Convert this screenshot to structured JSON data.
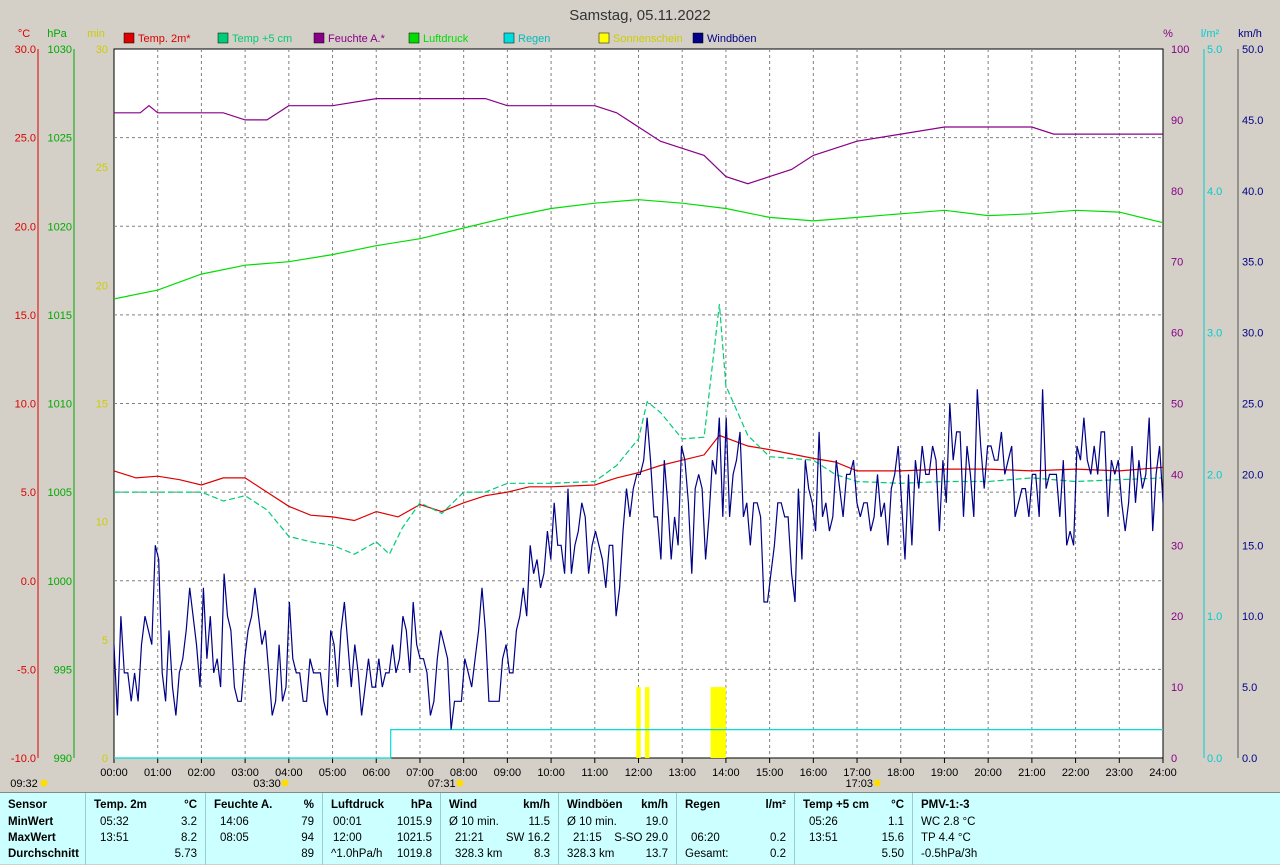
{
  "title": "Samstag, 05.11.2022",
  "colors": {
    "temp2m": "#dd0000",
    "temp5cm": "#00cc77",
    "humidity": "#880088",
    "pressure": "#00dd00",
    "rain": "#00dddd",
    "sunshine": "#ffff00",
    "gusts": "#000088",
    "grid": "#808080",
    "panel_bg": "#ccffff",
    "frame_bg": "#d4d0c8",
    "plot_bg": "#ffffff"
  },
  "legend": [
    {
      "label": "Temp. 2m*",
      "color": "#dd0000"
    },
    {
      "label": "Temp +5 cm",
      "color": "#00cc77"
    },
    {
      "label": "Feuchte A.*",
      "color": "#880088"
    },
    {
      "label": "Luftdruck",
      "color": "#00dd00"
    },
    {
      "label": "Regen",
      "color": "#00dddd"
    },
    {
      "label": "Sonnenschein",
      "color": "#ffff00"
    },
    {
      "label": "Windböen",
      "color": "#000088"
    }
  ],
  "axes": {
    "temp": {
      "unit": "°C",
      "min": -10,
      "max": 30,
      "ticks": [
        "-10.0",
        "-5.0",
        "0.0",
        "5.0",
        "10.0",
        "15.0",
        "20.0",
        "25.0",
        "30.0"
      ]
    },
    "pressure": {
      "unit": "hPa",
      "min": 990,
      "max": 1030,
      "ticks": [
        "990",
        "995",
        "1000",
        "1005",
        "1010",
        "1015",
        "1020",
        "1025",
        "1030"
      ]
    },
    "sun_min": {
      "unit": "min",
      "min": 0,
      "max": 30,
      "ticks": [
        "0",
        "5",
        "10",
        "15",
        "20",
        "25",
        "30"
      ]
    },
    "humidity": {
      "unit": "%",
      "min": 0,
      "max": 100,
      "ticks": [
        "0",
        "10",
        "20",
        "30",
        "40",
        "50",
        "60",
        "70",
        "80",
        "90",
        "100"
      ]
    },
    "rain": {
      "unit": "l/m²",
      "min": 0,
      "max": 5,
      "ticks": [
        "0.0",
        "1.0",
        "2.0",
        "3.0",
        "4.0",
        "5.0"
      ]
    },
    "wind": {
      "unit": "km/h",
      "min": 0,
      "max": 50,
      "ticks": [
        "0.0",
        "5.0",
        "10.0",
        "15.0",
        "20.0",
        "25.0",
        "30.0",
        "35.0",
        "40.0",
        "45.0",
        "50.0"
      ]
    },
    "x_ticks": [
      "00:00",
      "01:00",
      "02:00",
      "03:00",
      "04:00",
      "05:00",
      "06:00",
      "07:00",
      "08:00",
      "09:00",
      "10:00",
      "11:00",
      "12:00",
      "13:00",
      "14:00",
      "15:00",
      "16:00",
      "17:00",
      "18:00",
      "19:00",
      "20:00",
      "21:00",
      "22:00",
      "23:00",
      "24:00"
    ]
  },
  "markers": [
    {
      "label": "09:32",
      "hour": -2.5
    },
    {
      "label": "03:30",
      "hour": 3.5
    },
    {
      "label": "07:31",
      "hour": 7.5
    },
    {
      "label": "17:03",
      "hour": 17.05
    }
  ],
  "chart_data": {
    "type": "line",
    "x_unit": "hour",
    "series": [
      {
        "name": "Temp. 2m*",
        "axis": "temp",
        "style": "line",
        "points": [
          [
            0,
            6.2
          ],
          [
            0.5,
            5.8
          ],
          [
            1,
            5.9
          ],
          [
            1.5,
            5.7
          ],
          [
            2,
            5.4
          ],
          [
            2.5,
            5.8
          ],
          [
            3,
            5.8
          ],
          [
            3.5,
            5.0
          ],
          [
            4,
            4.2
          ],
          [
            4.5,
            3.7
          ],
          [
            5,
            3.6
          ],
          [
            5.5,
            3.4
          ],
          [
            6,
            3.9
          ],
          [
            6.5,
            3.6
          ],
          [
            7,
            4.3
          ],
          [
            7.5,
            3.9
          ],
          [
            8,
            4.4
          ],
          [
            8.5,
            4.8
          ],
          [
            9,
            5.0
          ],
          [
            9.5,
            5.3
          ],
          [
            10,
            5.3
          ],
          [
            11,
            5.4
          ],
          [
            11.5,
            5.8
          ],
          [
            12,
            6.1
          ],
          [
            12.5,
            6.5
          ],
          [
            13,
            6.8
          ],
          [
            13.5,
            7.1
          ],
          [
            13.85,
            8.2
          ],
          [
            14.5,
            7.6
          ],
          [
            15,
            7.4
          ],
          [
            16,
            6.9
          ],
          [
            16.5,
            6.7
          ],
          [
            17,
            6.2
          ],
          [
            18,
            6.2
          ],
          [
            19,
            6.3
          ],
          [
            20,
            6.3
          ],
          [
            21,
            6.2
          ],
          [
            22,
            6.3
          ],
          [
            23,
            6.2
          ],
          [
            24,
            6.4
          ]
        ]
      },
      {
        "name": "Temp +5 cm",
        "axis": "temp",
        "style": "dash",
        "points": [
          [
            0,
            5.0
          ],
          [
            1,
            5.0
          ],
          [
            2,
            5.0
          ],
          [
            2.5,
            4.5
          ],
          [
            3,
            4.8
          ],
          [
            3.5,
            4.0
          ],
          [
            4,
            2.5
          ],
          [
            4.5,
            2.2
          ],
          [
            5,
            2.0
          ],
          [
            5.5,
            1.5
          ],
          [
            6,
            2.2
          ],
          [
            6.3,
            1.5
          ],
          [
            6.6,
            3.0
          ],
          [
            7,
            4.4
          ],
          [
            7.5,
            3.8
          ],
          [
            8,
            5.0
          ],
          [
            8.5,
            5.0
          ],
          [
            9,
            5.5
          ],
          [
            10,
            5.5
          ],
          [
            11,
            5.6
          ],
          [
            11.5,
            6.5
          ],
          [
            12,
            8.0
          ],
          [
            12.2,
            10.1
          ],
          [
            12.5,
            9.5
          ],
          [
            13,
            8.0
          ],
          [
            13.5,
            8.1
          ],
          [
            13.85,
            15.6
          ],
          [
            14,
            11.0
          ],
          [
            14.5,
            8.2
          ],
          [
            15,
            7.0
          ],
          [
            16,
            6.8
          ],
          [
            16.5,
            6.0
          ],
          [
            17,
            5.6
          ],
          [
            18,
            5.5
          ],
          [
            19,
            5.6
          ],
          [
            20,
            5.6
          ],
          [
            21,
            5.8
          ],
          [
            22,
            5.6
          ],
          [
            23,
            5.7
          ],
          [
            24,
            5.8
          ]
        ]
      },
      {
        "name": "Feuchte A.*",
        "axis": "humidity",
        "style": "line",
        "points": [
          [
            0,
            91
          ],
          [
            0.6,
            91
          ],
          [
            0.8,
            92
          ],
          [
            1,
            91
          ],
          [
            2,
            91
          ],
          [
            2.5,
            91
          ],
          [
            3,
            90
          ],
          [
            3.5,
            90
          ],
          [
            4,
            92
          ],
          [
            5,
            92
          ],
          [
            6,
            93
          ],
          [
            7,
            93
          ],
          [
            8,
            93
          ],
          [
            8.5,
            93
          ],
          [
            9,
            92
          ],
          [
            10,
            92
          ],
          [
            11,
            92
          ],
          [
            11.5,
            91
          ],
          [
            12,
            89
          ],
          [
            12.5,
            87
          ],
          [
            13,
            86
          ],
          [
            13.5,
            85
          ],
          [
            14,
            82
          ],
          [
            14.5,
            81
          ],
          [
            15,
            82
          ],
          [
            15.5,
            83
          ],
          [
            16,
            85
          ],
          [
            17,
            87
          ],
          [
            18,
            88
          ],
          [
            19,
            89
          ],
          [
            20,
            89
          ],
          [
            21,
            89
          ],
          [
            21.5,
            88
          ],
          [
            22,
            88
          ],
          [
            23,
            88
          ],
          [
            24,
            88
          ]
        ]
      },
      {
        "name": "Luftdruck",
        "axis": "pressure",
        "style": "line",
        "points": [
          [
            0,
            1015.9
          ],
          [
            1,
            1016.4
          ],
          [
            2,
            1017.3
          ],
          [
            3,
            1017.8
          ],
          [
            4,
            1018.0
          ],
          [
            5,
            1018.4
          ],
          [
            6,
            1018.9
          ],
          [
            7,
            1019.3
          ],
          [
            8,
            1019.9
          ],
          [
            9,
            1020.5
          ],
          [
            10,
            1021.0
          ],
          [
            11,
            1021.3
          ],
          [
            12,
            1021.5
          ],
          [
            13,
            1021.3
          ],
          [
            14,
            1021.0
          ],
          [
            15,
            1020.5
          ],
          [
            16,
            1020.3
          ],
          [
            17,
            1020.5
          ],
          [
            18,
            1020.7
          ],
          [
            19,
            1020.9
          ],
          [
            20,
            1020.6
          ],
          [
            21,
            1020.7
          ],
          [
            22,
            1020.9
          ],
          [
            23,
            1020.8
          ],
          [
            24,
            1020.2
          ]
        ]
      },
      {
        "name": "Regen",
        "axis": "rain",
        "style": "step",
        "points": [
          [
            0,
            0
          ],
          [
            6.33,
            0
          ],
          [
            6.33,
            0.2
          ],
          [
            24,
            0.2
          ]
        ]
      },
      {
        "name": "Sonnenschein",
        "axis": "sun_min",
        "style": "bars",
        "bars": [
          [
            11.95,
            12.05,
            3
          ],
          [
            12.15,
            12.25,
            3
          ],
          [
            13.65,
            14.0,
            3
          ]
        ]
      },
      {
        "name": "Windböen",
        "axis": "wind",
        "style": "line",
        "values": [
          8.0,
          3.0,
          10.0,
          6.0,
          6.0,
          4.0,
          6.0,
          4.0,
          8.0,
          10.0,
          9.0,
          8.0,
          15.0,
          14.0,
          6.0,
          4.0,
          9.0,
          5.0,
          3.0,
          6.0,
          7.0,
          9.0,
          12.0,
          10.0,
          8.0,
          5.0,
          12.0,
          7.0,
          10.0,
          6.0,
          7.0,
          5.0,
          13.0,
          10.0,
          9.0,
          5.0,
          4.0,
          4.0,
          7.0,
          9.0,
          10.0,
          12.0,
          10.0,
          8.0,
          9.0,
          6.0,
          3.0,
          4.0,
          8.0,
          4.0,
          5.0,
          11.0,
          7.0,
          6.0,
          6.0,
          4.0,
          4.0,
          7.0,
          6.0,
          6.0,
          6.0,
          4.0,
          3.0,
          9.0,
          8.0,
          5.0,
          9.0,
          11.0,
          8.0,
          5.0,
          8.0,
          6.0,
          3.0,
          5.0,
          7.0,
          5.0,
          5.0,
          7.0,
          5.0,
          6.0,
          6.0,
          8.0,
          6.0,
          7.0,
          10.0,
          9.0,
          6.0,
          11.0,
          8.0,
          7.0,
          7.0,
          6.0,
          3.0,
          4.0,
          7.0,
          9.0,
          8.0,
          7.0,
          2.0,
          4.0,
          4.0,
          4.0,
          7.0,
          6.0,
          5.0,
          7.0,
          9.0,
          12.0,
          9.0,
          4.0,
          4.0,
          4.0,
          4.0,
          7.0,
          8.0,
          6.0,
          6.0,
          9.0,
          10.0,
          12.0,
          10.0,
          15.0,
          13.0,
          14.0,
          12.0,
          13.0,
          16.0,
          14.0,
          18.0,
          15.0,
          15.0,
          13.0,
          19.0,
          13.0,
          15.0,
          16.0,
          18.0,
          17.0,
          13.0,
          15.0,
          16.0,
          15.0,
          14.0,
          12.0,
          15.0,
          15.0,
          10.0,
          12.0,
          16.0,
          19.0,
          17.0,
          19.0,
          20.0,
          20.0,
          21.0,
          24.0,
          21.0,
          17.0,
          17.0,
          14.0,
          21.0,
          18.0,
          14.0,
          17.0,
          15.0,
          22.0,
          21.0,
          18.0,
          13.0,
          19.0,
          20.0,
          19.0,
          14.0,
          17.0,
          21.0,
          20.0,
          24.0,
          17.0,
          24.0,
          17.0,
          20.0,
          21.0,
          23.0,
          17.0,
          18.0,
          15.0,
          18.0,
          18.0,
          17.0,
          11.0,
          11.0,
          13.0,
          15.0,
          18.0,
          18.0,
          17.0,
          17.0,
          13.0,
          11.0,
          19.0,
          14.0,
          21.0,
          19.0,
          18.0,
          16.0,
          23.0,
          17.0,
          18.0,
          16.0,
          17.0,
          21.0,
          19.0,
          17.0,
          20.0,
          20.0,
          21.0,
          18.0,
          17.0,
          18.0,
          18.0,
          16.0,
          17.0,
          20.0,
          17.0,
          18.0,
          15.0,
          19.0,
          20.0,
          22.0,
          18.0,
          14.0,
          20.0,
          15.0,
          21.0,
          19.0,
          22.0,
          20.0,
          20.0,
          22.0,
          21.0,
          16.0,
          21.0,
          18.0,
          25.0,
          21.0,
          23.0,
          23.0,
          17.0,
          22.0,
          20.0,
          17.0,
          26.0,
          22.0,
          19.0,
          22.0,
          22.0,
          21.0,
          21.0,
          23.0,
          20.0,
          21.0,
          22.0,
          17.0,
          18.0,
          19.0,
          19.0,
          17.0,
          20.0,
          20.0,
          17.0,
          26.0,
          19.0,
          20.0,
          20.0,
          20.0,
          17.0,
          21.0,
          15.0,
          16.0,
          15.0,
          22.0,
          21.0,
          24.0,
          21.0,
          20.0,
          22.0,
          20.0,
          23.0,
          23.0,
          17.0,
          21.0,
          20.0,
          21.0,
          18.0,
          16.0,
          18.0,
          22.0,
          18.0,
          21.0,
          19.0,
          20.0,
          24.0,
          16.0,
          20.0,
          22.0,
          18.0
        ]
      }
    ]
  },
  "stats": {
    "row_labels": [
      "Sensor",
      "MinWert",
      "MaxWert",
      "Durchschnitt"
    ],
    "temp2m": {
      "title": "Temp. 2m",
      "unit": "°C",
      "min_time": "05:32",
      "min": "3.2",
      "max_time": "13:51",
      "max": "8.2",
      "avg": "5.73"
    },
    "humidity": {
      "title": "Feuchte A.",
      "unit": "%",
      "min_time": "14:06",
      "min": "79",
      "max_time": "08:05",
      "max": "94",
      "avg": "89"
    },
    "pressure": {
      "title": "Luftdruck",
      "unit": "hPa",
      "min_time": "00:01",
      "min": "1015.9",
      "max_time": "12:00",
      "max": "1021.5",
      "trend": "^1.0hPa/h",
      "avg": "1019.8"
    },
    "wind": {
      "title": "Wind",
      "unit": "km/h",
      "r1a": "Ø 10 min.",
      "r1b": "11.5",
      "r2a": "21:21",
      "r2b": "SW 16.2",
      "r3a": "328.3 km",
      "r3b": "8.3"
    },
    "gusts": {
      "title": "Windböen",
      "unit": "km/h",
      "r1a": "Ø 10 min.",
      "r1b": "19.0",
      "r2a": "21:15",
      "r2b": "S-SO 29.0",
      "r3a": "328.3 km",
      "r3b": "13.7"
    },
    "rain": {
      "title": "Regen",
      "unit": "l/m²",
      "r2a": "06:20",
      "r2b": "0.2",
      "r3a": "Gesamt:",
      "r3b": "0.2"
    },
    "temp5cm": {
      "title": "Temp +5 cm",
      "unit": "°C",
      "min_time": "05:26",
      "min": "1.1",
      "max_time": "13:51",
      "max": "15.6",
      "avg": "5.50"
    },
    "pmv": {
      "title": "PMV-1:-3",
      "r1": "WC 2.8 °C",
      "r2": "TP 4.4 °C",
      "r3": "-0.5hPa/3h"
    }
  }
}
